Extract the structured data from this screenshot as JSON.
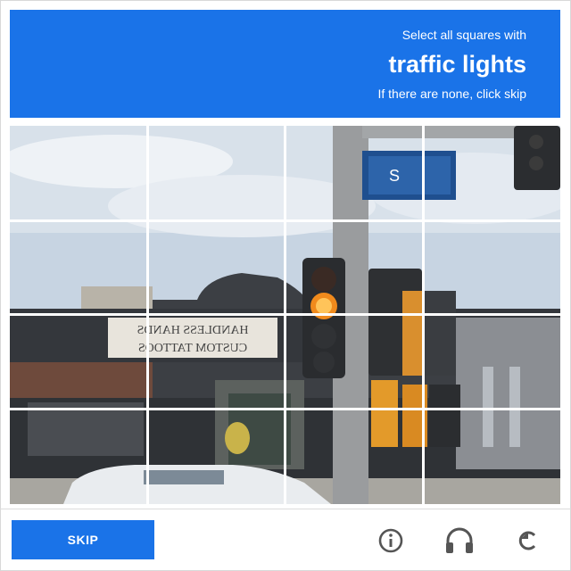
{
  "header": {
    "line1": "Select all squares with",
    "target": "traffic lights",
    "line3": "If there are none, click skip"
  },
  "grid": {
    "rows": 4,
    "cols": 4
  },
  "footer": {
    "skip_label": "SKIP",
    "icons": [
      "info-icon",
      "headphones-icon",
      "reload-icon"
    ]
  },
  "scene": {
    "sign_text_1": "HANDLESS HANDS",
    "sign_text_2": "CUSTOM TATTOOS",
    "street_sign": "S"
  },
  "colors": {
    "accent": "#1a73e8"
  }
}
